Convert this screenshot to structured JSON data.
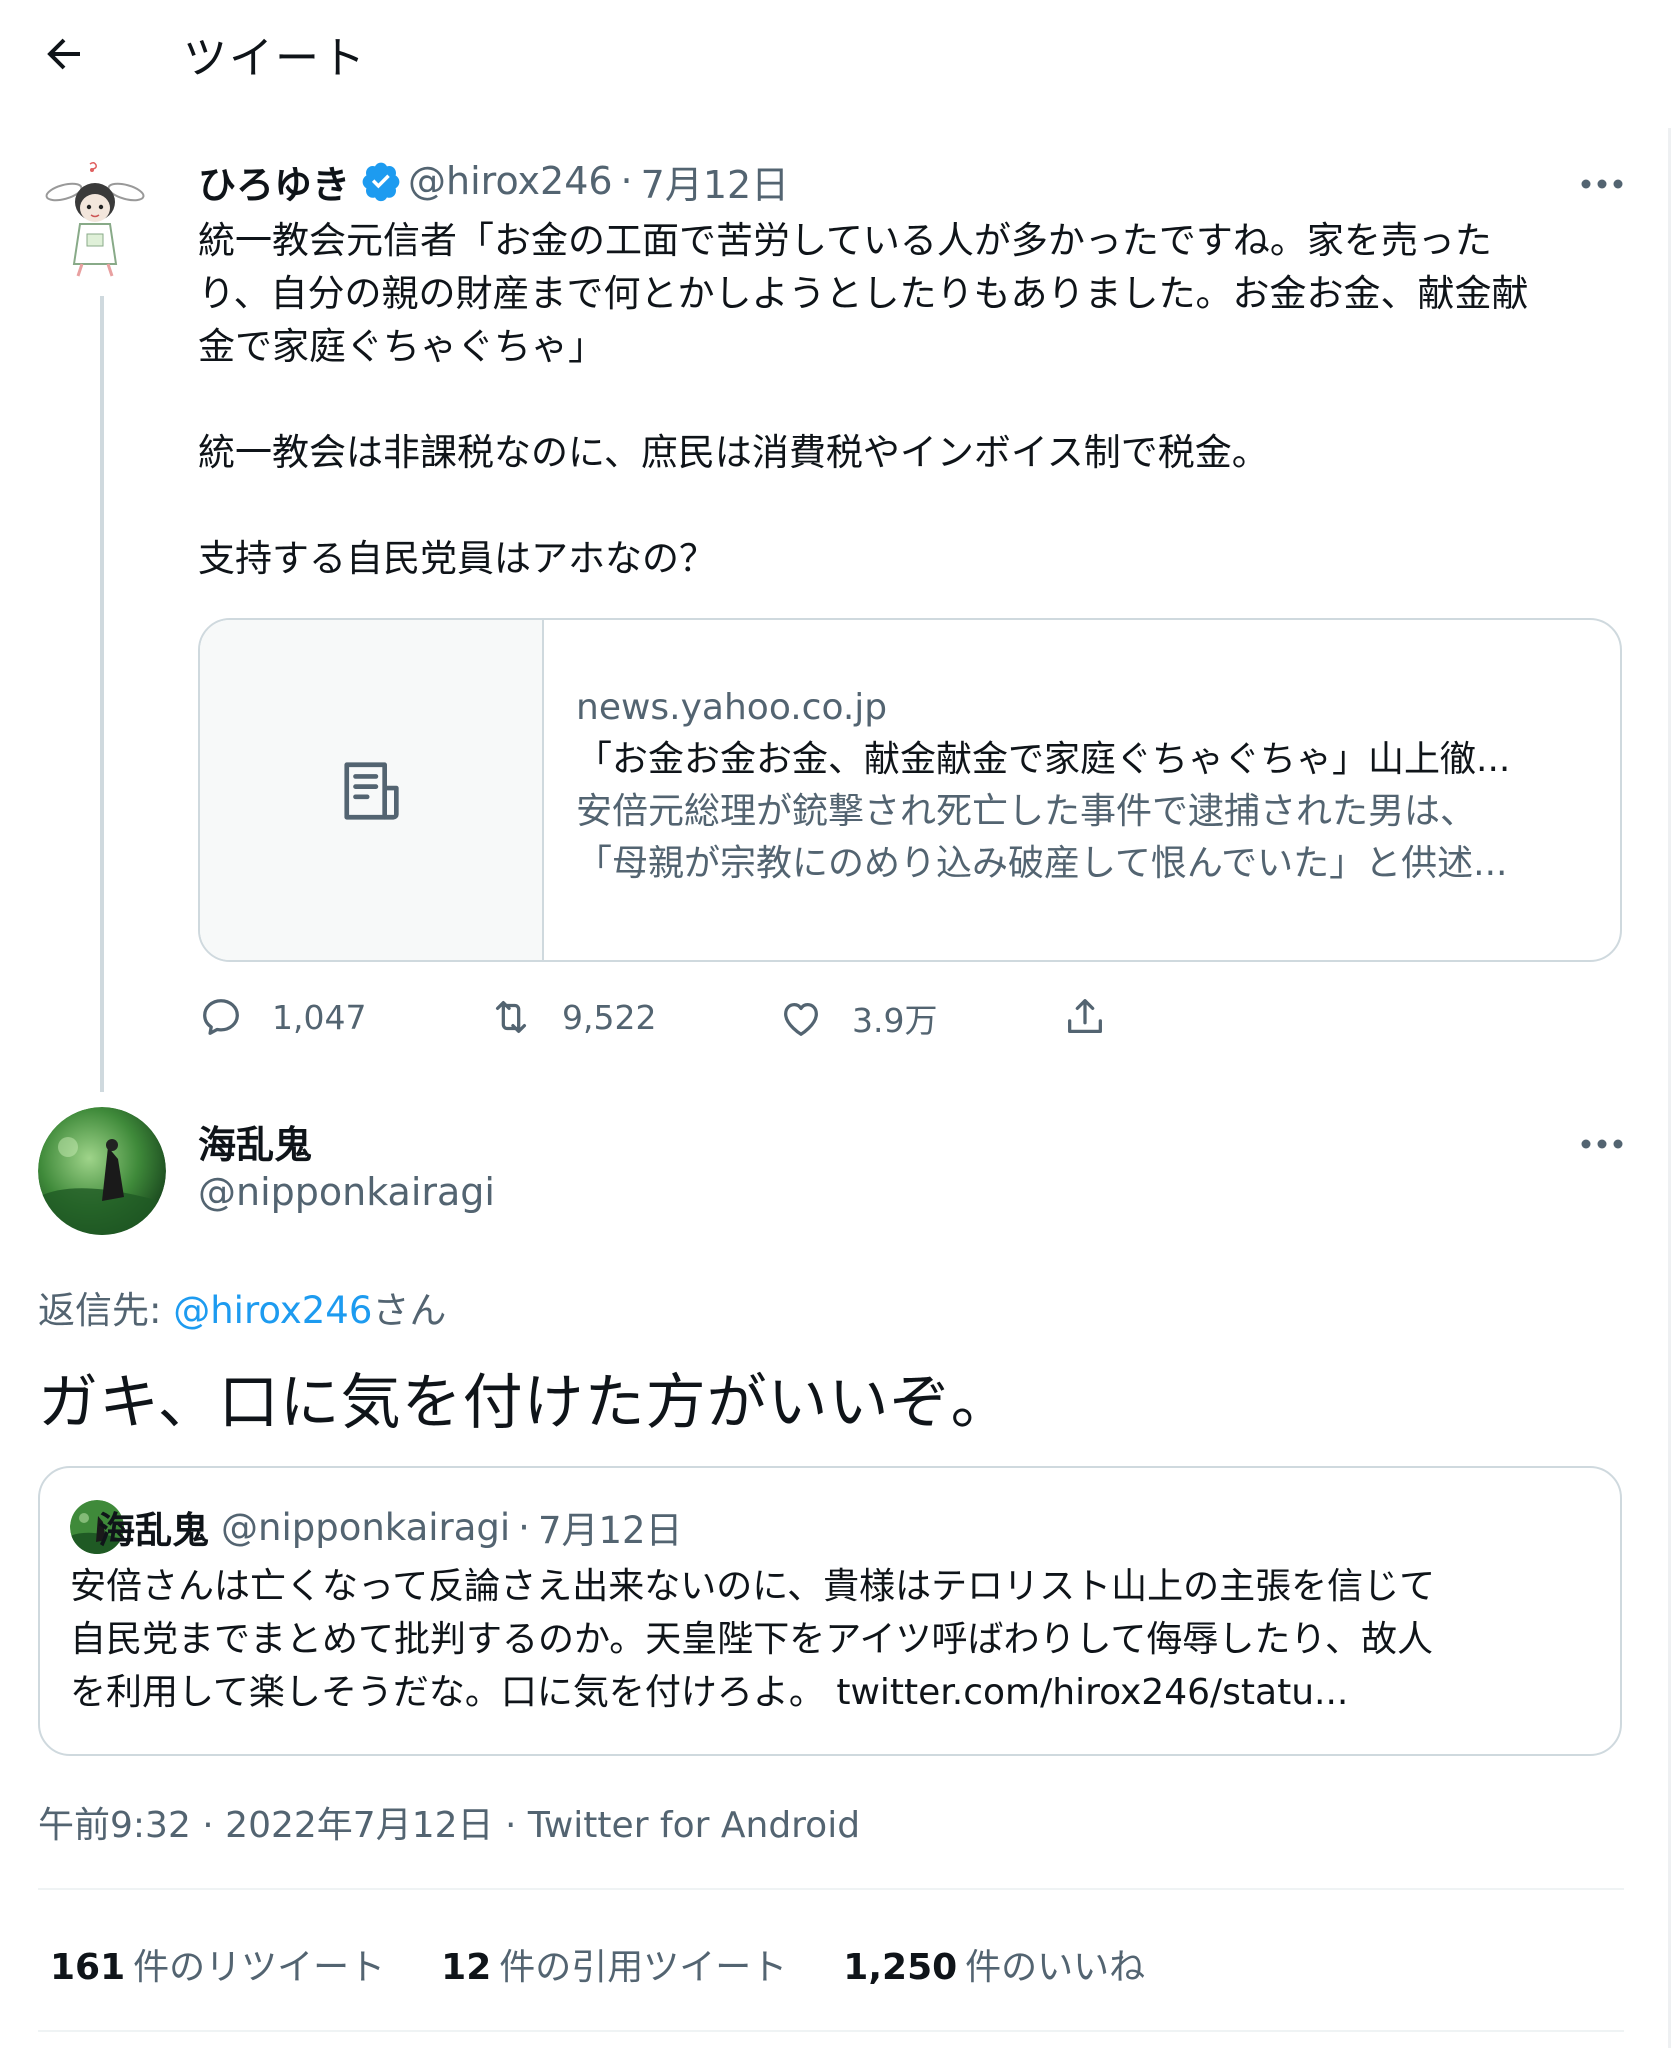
{
  "header": {
    "title": "ツイート"
  },
  "tweet1": {
    "name": "ひろゆき",
    "handle": "@hirox246",
    "sep": "·",
    "date": "7月12日",
    "body_lines": [
      "統一教会元信者「お金の工面で苦労している人が多かったですね。家を売った",
      "り、自分の親の財産まで何とかしようとしたりもありました。お金お金、献金献",
      "金で家庭ぐちゃぐちゃ」",
      "統一教会は非課税なのに、庶民は消費税やインボイス制で税金。",
      "支持する自民党員はアホなの？"
    ],
    "card": {
      "domain": "news.yahoo.co.jp",
      "title": "「お金お金お金、献金献金で家庭ぐちゃぐちゃ」山上徹...",
      "desc_line1": "安倍元総理が銃撃され死亡した事件で逮捕された男は、",
      "desc_line2": "「母親が宗教にのめり込み破産して恨んでいた」と供述..."
    },
    "actions": {
      "replies": "1,047",
      "retweets": "9,522",
      "likes": "3.9万"
    }
  },
  "tweet2": {
    "name": "海乱鬼",
    "handle": "@nipponkairagi",
    "reply_label": "返信先: ",
    "reply_mention": "@hirox246",
    "reply_suffix": "さん",
    "text": "ガキ、口に気を付けた方がいいぞ。",
    "quote": {
      "name": "海乱鬼",
      "handle": "@nipponkairagi",
      "sep": "·",
      "date": "7月12日",
      "lines": [
        "安倍さんは亡くなって反論さえ出来ないのに、貴様はテロリスト山上の主張を信じて",
        "自民党までまとめて批判するのか。天皇陛下をアイツ呼ばわりして侮辱したり、故人",
        "を利用して楽しそうだな。口に気を付けろよ。 twitter.com/hirox246/statu..."
      ]
    },
    "meta": "午前9:32 · 2022年7月12日 · Twitter for Android",
    "stats": {
      "retweets_count": "161",
      "retweets_label": "件のリツイート",
      "quotes_count": "12",
      "quotes_label": "件の引用ツイート",
      "likes_count": "1,250",
      "likes_label": "件のいいね"
    }
  },
  "colors": {
    "accent": "#1d9bf0",
    "muted": "#536471",
    "text": "#0f1419",
    "border": "#cfd9de"
  }
}
